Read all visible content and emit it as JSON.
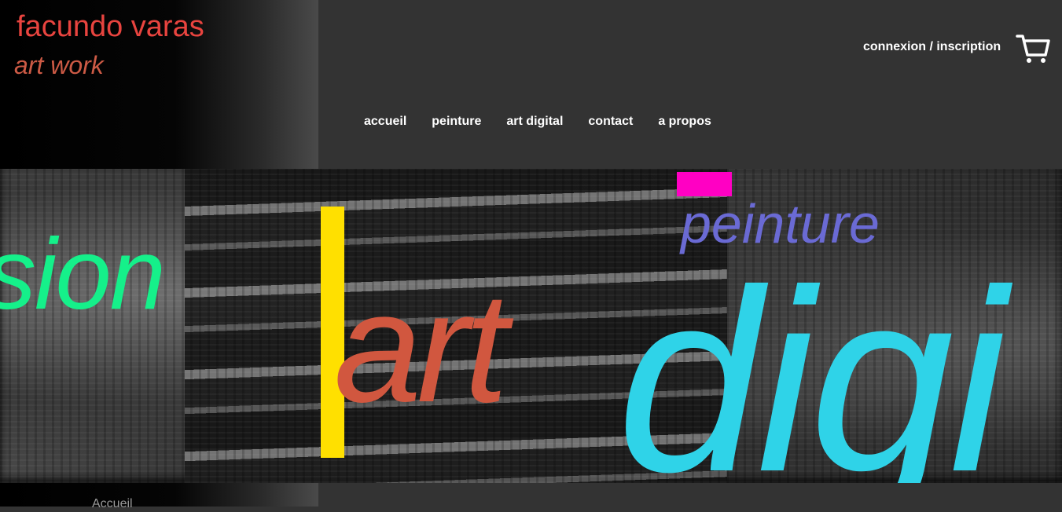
{
  "brand": {
    "name": "facundo varas",
    "tagline": "art work"
  },
  "header": {
    "login_label": "connexion / inscription",
    "cart_icon": "cart-icon"
  },
  "nav": {
    "items": [
      {
        "label": "accueil"
      },
      {
        "label": "peinture"
      },
      {
        "label": "art digital"
      },
      {
        "label": "contact"
      },
      {
        "label": "a propos"
      }
    ]
  },
  "hero": {
    "words": {
      "sion": "sion",
      "art": "art",
      "peinture": "peinture",
      "digi": "digi"
    },
    "colors": {
      "sion": "#15f08a",
      "art": "#d1573f",
      "peinture": "#6a6ad4",
      "digi": "#2fd3e8",
      "bar": "#ffe000",
      "block": "#ff00c3"
    }
  },
  "breadcrumb": {
    "current": "Accueil"
  },
  "colors": {
    "brand_name": "#e8443f",
    "brand_tagline": "#cc5a45",
    "header_bg": "#333333"
  }
}
